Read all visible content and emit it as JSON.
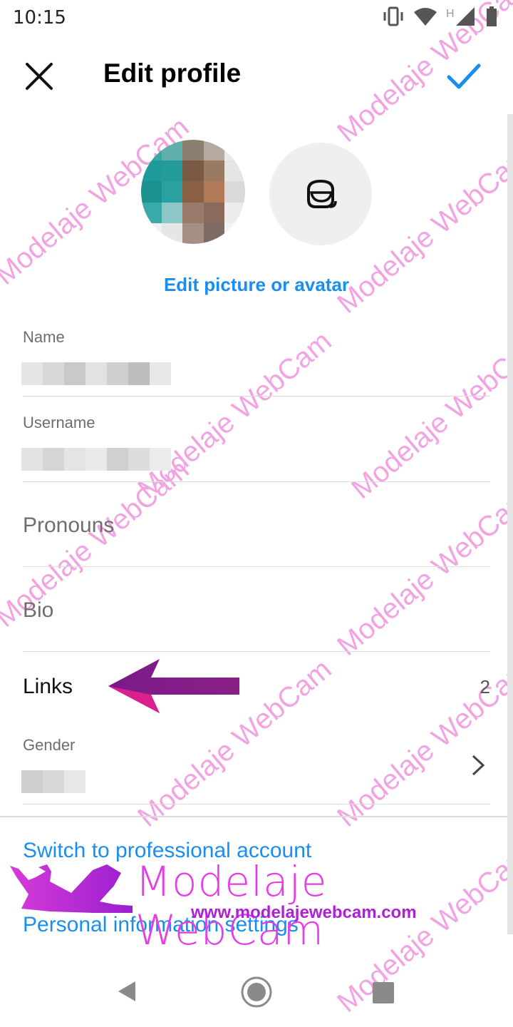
{
  "status_bar": {
    "time": "10:15",
    "icons": [
      "vibrate-icon",
      "wifi-icon",
      "signal-icon",
      "battery-icon"
    ],
    "network_type": "H"
  },
  "toolbar": {
    "title": "Edit profile",
    "close_icon": "close-icon",
    "confirm_icon": "check-icon",
    "accent_color": "#1a8ef0"
  },
  "profile": {
    "edit_picture_label": "Edit picture or avatar",
    "avatar_icon": "avatar-sticker-icon"
  },
  "fields": {
    "name_label": "Name",
    "username_label": "Username",
    "pronouns_label": "Pronouns",
    "bio_label": "Bio",
    "links_label": "Links",
    "links_count": "2",
    "gender_label": "Gender"
  },
  "actions": {
    "switch_professional": "Switch to professional account",
    "personal_info": "Personal information settings"
  },
  "watermark": {
    "brand": "Modelaje WebCam",
    "url": "www.modelajewebcam.com",
    "brand_color": "#e63be6",
    "url_color": "#b01fd8"
  },
  "nav": {
    "back_icon": "back-triangle-icon",
    "home_icon": "home-circle-icon",
    "recents_icon": "recents-square-icon"
  }
}
